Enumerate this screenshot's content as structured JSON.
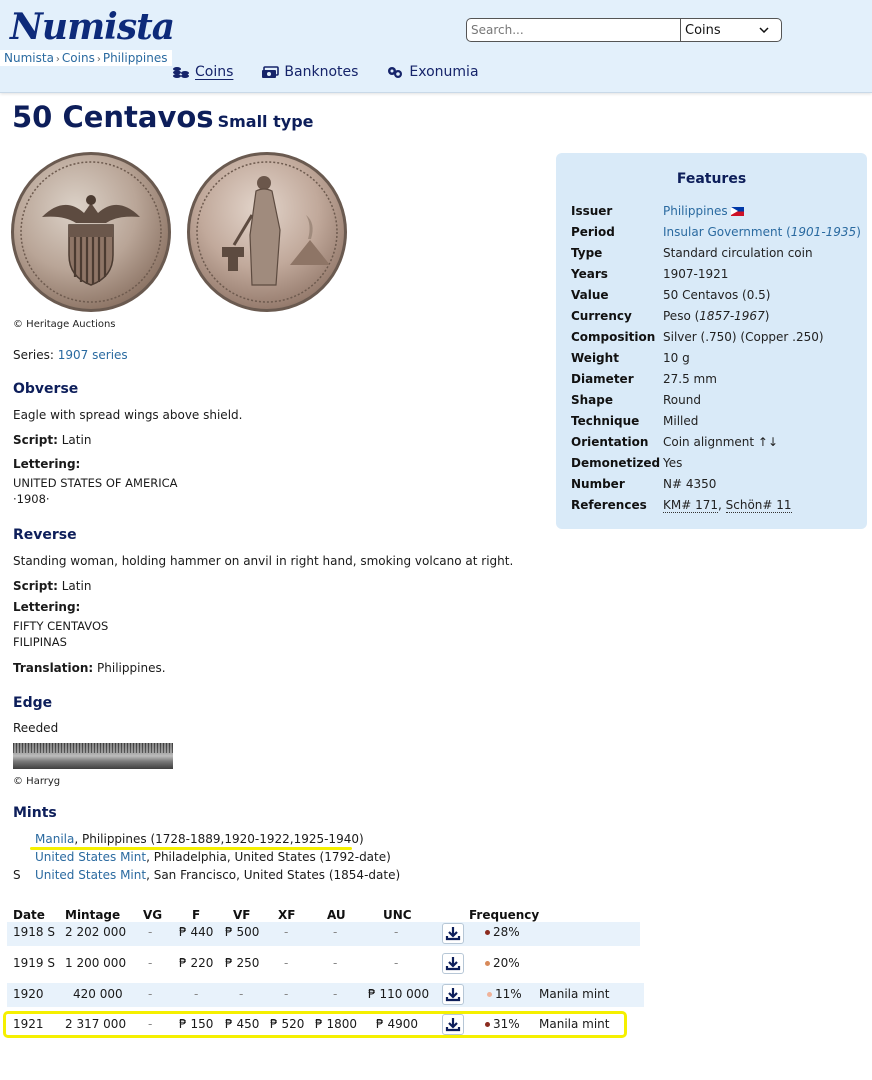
{
  "header": {
    "logo": "Numista",
    "breadcrumb": [
      "Numista",
      "Coins",
      "Philippines"
    ],
    "search_placeholder": "Search...",
    "search_category": "Coins",
    "nav": [
      {
        "label": "Coins",
        "icon": "coins-icon",
        "active": true
      },
      {
        "label": "Banknotes",
        "icon": "banknotes-icon",
        "active": false
      },
      {
        "label": "Exonumia",
        "icon": "exonumia-icon",
        "active": false
      }
    ]
  },
  "title": {
    "main": "50 Centavos",
    "sub": "Small type"
  },
  "images": {
    "coin_credit": "© Heritage Auctions",
    "edge_credit": "© Harryg"
  },
  "series": {
    "label": "Series:",
    "value": "1907 series"
  },
  "obverse": {
    "heading": "Obverse",
    "description": "Eagle with spread wings above shield.",
    "script_label": "Script:",
    "script": "Latin",
    "lettering_label": "Lettering:",
    "lettering": [
      "UNITED STATES OF AMERICA",
      "·1908·"
    ]
  },
  "reverse": {
    "heading": "Reverse",
    "description": "Standing woman, holding hammer on anvil in right hand, smoking volcano at right.",
    "script_label": "Script:",
    "script": "Latin",
    "lettering_label": "Lettering:",
    "lettering": [
      "FIFTY CENTAVOS",
      "FILIPINAS"
    ],
    "translation_label": "Translation:",
    "translation": "Philippines."
  },
  "edge": {
    "heading": "Edge",
    "description": "Reeded"
  },
  "mints": {
    "heading": "Mints",
    "items": [
      {
        "mark": "",
        "name": "Manila",
        "rest": ", Philippines (1728-1889,1920-1922,1925-1940)"
      },
      {
        "mark": "",
        "name": "United States Mint",
        "rest": ", Philadelphia, United States (1792-date)"
      },
      {
        "mark": "S",
        "name": "United States Mint",
        "rest": ", San Francisco, United States (1854-date)"
      }
    ]
  },
  "features": {
    "heading": "Features",
    "issuer": {
      "label": "Issuer",
      "value": "Philippines"
    },
    "period": {
      "label": "Period",
      "value": "Insular Government",
      "years": "1901-1935"
    },
    "type": {
      "label": "Type",
      "value": "Standard circulation coin"
    },
    "years": {
      "label": "Years",
      "value": "1907-1921"
    },
    "value": {
      "label": "Value",
      "value": "50 Centavos (0.5)"
    },
    "currency": {
      "label": "Currency",
      "value": "Peso",
      "years": "1857-1967"
    },
    "composition": {
      "label": "Composition",
      "value": "Silver (.750) (Copper .250)"
    },
    "weight": {
      "label": "Weight",
      "value": "10 g"
    },
    "diameter": {
      "label": "Diameter",
      "value": "27.5 mm"
    },
    "shape": {
      "label": "Shape",
      "value": "Round"
    },
    "technique": {
      "label": "Technique",
      "value": "Milled"
    },
    "orientation": {
      "label": "Orientation",
      "value": "Coin alignment ↑↓"
    },
    "demonetized": {
      "label": "Demonetized",
      "value": "Yes"
    },
    "number": {
      "label": "Number",
      "value": "N# 4350"
    },
    "references": {
      "label": "References",
      "km": "KM# 171",
      "schon": "Schön# 11"
    }
  },
  "table": {
    "headers": {
      "date": "Date",
      "mintage": "Mintage",
      "vg": "VG",
      "f": "F",
      "vf": "VF",
      "xf": "XF",
      "au": "AU",
      "unc": "UNC",
      "frequency": "Frequency"
    },
    "rows": [
      {
        "date": "1918 S",
        "mintage": "2 202 000",
        "vg": "-",
        "f": "₱ 440",
        "vf": "₱ 500",
        "xf": "-",
        "au": "-",
        "unc": "-",
        "frequency": "28%",
        "dot_color": "#8b2b1e",
        "note": ""
      },
      {
        "date": "1919 S",
        "mintage": "1 200 000",
        "vg": "-",
        "f": "₱ 220",
        "vf": "₱ 250",
        "xf": "-",
        "au": "-",
        "unc": "-",
        "frequency": "20%",
        "dot_color": "#d88a5a",
        "note": ""
      },
      {
        "date": "1920",
        "mintage": "420 000",
        "vg": "-",
        "f": "-",
        "vf": "-",
        "xf": "-",
        "au": "-",
        "unc": "₱ 110 000",
        "frequency": "11%",
        "dot_color": "#f0b39a",
        "note": "Manila mint"
      },
      {
        "date": "1921",
        "mintage": "2 317 000",
        "vg": "-",
        "f": "₱ 150",
        "vf": "₱ 450",
        "xf": "₱ 520",
        "au": "₱ 1800",
        "unc": "₱ 4900",
        "frequency": "31%",
        "dot_color": "#8b2b1e",
        "note": "Manila mint"
      }
    ]
  },
  "colors": {
    "accent": "#0d1e5a",
    "link": "#2a6aa0",
    "header_bg": "#e3f0fb",
    "features_bg": "#d9eaf8",
    "highlight": "#f5f000"
  }
}
